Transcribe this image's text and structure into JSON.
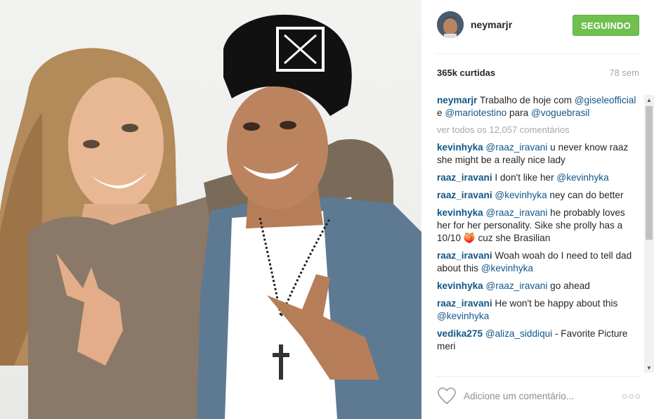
{
  "post": {
    "username": "neymarjr",
    "follow_label": "SEGUINDO",
    "likes": "365k curtidas",
    "time_ago": "78 sem",
    "caption": {
      "user": "neymarjr",
      "text_1": "Trabalho de hoje com",
      "mention_1": "@giseleofficial",
      "text_2": "e",
      "mention_2": "@mariotestino",
      "text_3": "para",
      "mention_3": "@voguebrasil"
    },
    "view_all": "ver todos os 12,057 comentários",
    "comments": [
      {
        "user": "kevinhyka",
        "mention": "@raaz_iravani",
        "text": "u never know raaz she might be a really nice lady",
        "mention_after": ""
      },
      {
        "user": "raaz_iravani",
        "mention": "",
        "text": "I don't like her",
        "mention_after": "@kevinhyka"
      },
      {
        "user": "raaz_iravani",
        "mention": "@kevinhyka",
        "text": "ney can do better",
        "mention_after": ""
      },
      {
        "user": "kevinhyka",
        "mention": "@raaz_iravani",
        "text": "he probably loves her for her personality. Sike she prolly has a 10/10 🍑 cuz she Brasilian",
        "mention_after": ""
      },
      {
        "user": "raaz_iravani",
        "mention": "",
        "text": "Woah woah do I need to tell dad about this",
        "mention_after": "@kevinhyka"
      },
      {
        "user": "kevinhyka",
        "mention": "@raaz_iravani",
        "text": "go ahead",
        "mention_after": ""
      },
      {
        "user": "raaz_iravani",
        "mention": "",
        "text": "He won't be happy about this",
        "mention_after": "@kevinhyka"
      },
      {
        "user": "vedika275",
        "mention": "@aliza_siddiqui",
        "text": "- Favorite Picture meri",
        "mention_after": ""
      }
    ],
    "comment_placeholder": "Adicione um comentário...",
    "more_label": "○○○"
  },
  "colors": {
    "link": "#125688",
    "follow_green": "#70c050",
    "muted": "#a5a7aa"
  },
  "icons": {
    "heart": "heart-icon",
    "more": "more-options-icon"
  }
}
